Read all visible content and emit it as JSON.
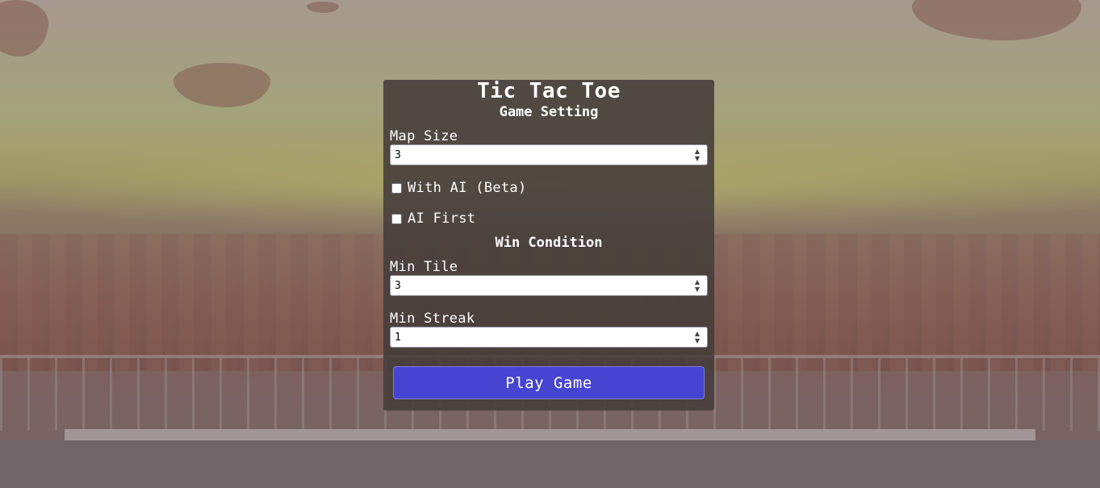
{
  "game": {
    "title": "Tic Tac Toe",
    "setting_heading": "Game Setting",
    "map_size": {
      "label": "Map Size",
      "value": "3"
    },
    "with_ai": {
      "label": "With AI (Beta)",
      "checked": false
    },
    "ai_first": {
      "label": "AI First",
      "checked": false
    },
    "win_condition_heading": "Win Condition",
    "min_tile": {
      "label": "Min Tile",
      "value": "3"
    },
    "min_streak": {
      "label": "Min Streak",
      "value": "1"
    },
    "play_button_label": "Play Game"
  },
  "colors": {
    "panel_background": "#443c3a",
    "play_button": "#4545d1",
    "text": "#ffffff"
  },
  "icons": {
    "spinner": "up-down-stepper-icon"
  }
}
